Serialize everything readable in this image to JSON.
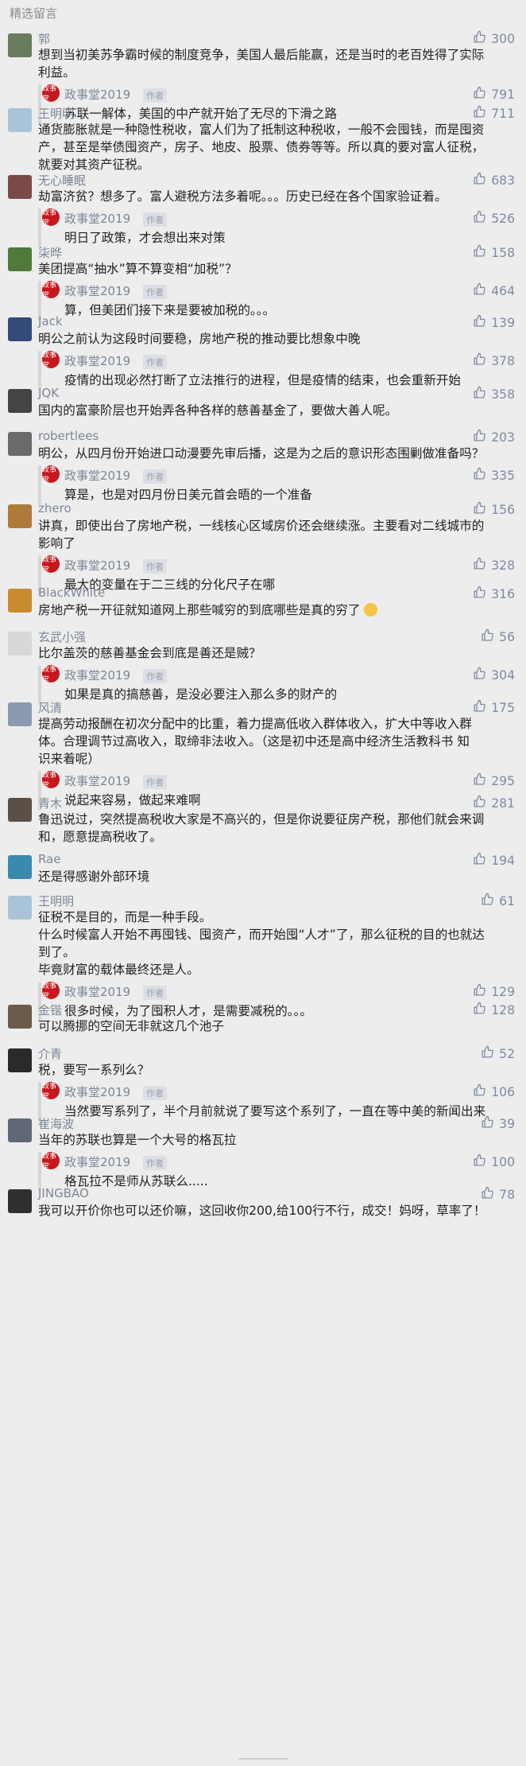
{
  "section_title": "精选留言",
  "reply_author": "政事堂2019",
  "reply_tag": "作者",
  "reply_avatar_text": "政事堂",
  "comments": [
    {
      "name": "郭",
      "likes": "300",
      "lines": [
        "想到当初美苏争霸时候的制度竞争，美国人最后能赢，还是当时的老百姓得了实际",
        "利益。"
      ],
      "reply_likes": "791",
      "reply_lines": [
        "苏联一解体，美国的中产就开始了无尽的下滑之路"
      ]
    },
    {
      "name": "王明明",
      "likes": "711",
      "lines": [
        "通货膨胀就是一种隐性税收，富人们为了抵制这种税收，一般不会囤钱，而是囤资",
        "产，甚至是举债囤资产，房子、地皮、股票、债券等等。所以真的要对富人征税，",
        "就要对其资产征税。"
      ]
    },
    {
      "name": "无心睡眠",
      "likes": "683",
      "lines": [
        "劫富济贫？想多了。富人避税方法多着呢。。。历史已经在各个国家验证着。"
      ],
      "reply_likes": "526",
      "reply_lines": [
        "明日了政策，才会想出来对策"
      ]
    },
    {
      "name": "柒晔",
      "likes": "158",
      "lines": [
        "美团提高“抽水”算不算变相“加税”？"
      ],
      "reply_likes": "464",
      "reply_lines": [
        "算，但美团们接下来是要被加税的。。。"
      ]
    },
    {
      "name": "Jack",
      "likes": "139",
      "lines": [
        "明公之前认为这段时间要稳，房地产税的推动要比想象中晚"
      ],
      "reply_likes": "378",
      "reply_lines": [
        "疫情的出现必然打断了立法推行的进程，但是疫情的结束，也会重新开始"
      ]
    },
    {
      "name": "JQK",
      "likes": "358",
      "lines": [
        "国内的富豪阶层也开始弄各种各样的慈善基金了，要做大善人呢。"
      ]
    },
    {
      "name": "robertlees",
      "likes": "203",
      "lines": [
        "明公，从四月份开始进口动漫要先审后播，这是为之后的意识形态围剿做准备吗？"
      ],
      "reply_likes": "335",
      "reply_lines": [
        "算是，也是对四月份日美元首会晤的一个准备"
      ]
    },
    {
      "name": "zhero",
      "likes": "156",
      "lines": [
        "讲真，即使出台了房地产税，一线核心区域房价还会继续涨。主要看对二线城市的",
        "影响了"
      ],
      "reply_likes": "328",
      "reply_lines": [
        "最大的变量在于二三线的分化尺子在哪"
      ]
    },
    {
      "name": "BlackWhite",
      "likes": "316",
      "lines": [
        "房地产税一开征就知道网上那些喊穷的到底哪些是真的穷了"
      ],
      "emoji": true
    },
    {
      "name": "玄武小强",
      "likes": "56",
      "lines": [
        "比尔盖茨的慈善基金会到底是善还是贼？"
      ],
      "reply_likes": "304",
      "reply_lines": [
        "如果是真的搞慈善，是没必要注入那么多的财产的"
      ]
    },
    {
      "name": "风清",
      "likes": "175",
      "lines": [
        "提高劳动报酬在初次分配中的比重，着力提高低收入群体收入，扩大中等收入群",
        "体。合理调节过高收入，取缔非法收入。（这是初中还是高中经济生活教科书  知",
        "识来着呢）"
      ],
      "reply_likes": "295",
      "reply_lines": [
        "说起来容易，做起来难啊"
      ]
    },
    {
      "name": "青木",
      "likes": "281",
      "lines": [
        "鲁迅说过，突然提高税收大家是不高兴的，但是你说要征房产税，那他们就会来调",
        "和，愿意提高税收了。"
      ]
    },
    {
      "name": "Rae",
      "likes": "194",
      "lines": [
        "还是得感谢外部环境"
      ]
    },
    {
      "name": "王明明",
      "likes": "61",
      "lines": [
        "征税不是目的，而是一种手段。",
        "什么时候富人开始不再囤钱、囤资产，而开始囤“人才”了，那么征税的目的也就达",
        "到了。",
        "毕竟财富的载体最终还是人。"
      ],
      "reply_likes": "129",
      "reply_lines": [
        "很多时候，为了囤积人才，是需要减税的。。。"
      ]
    },
    {
      "name": "金锴",
      "likes": "128",
      "lines": [
        "可以腾挪的空间无非就这几个池子"
      ]
    },
    {
      "name": "介青",
      "likes": "52",
      "lines": [
        "税，要写一系列么？"
      ],
      "reply_likes": "106",
      "reply_lines": [
        "当然要写系列了，半个月前就说了要写这个系列了，一直在等中美的新闻出来"
      ]
    },
    {
      "name": "崔海波",
      "likes": "39",
      "lines": [
        "当年的苏联也算是一个大号的格瓦拉"
      ],
      "reply_likes": "100",
      "reply_lines": [
        "格瓦拉不是师从苏联么....."
      ]
    },
    {
      "name": "JINGBAO",
      "likes": "78",
      "lines": [
        "我可以开价你也可以还价嘛，这回收你200,给100行不行，成交！妈呀，草率了！"
      ]
    }
  ]
}
